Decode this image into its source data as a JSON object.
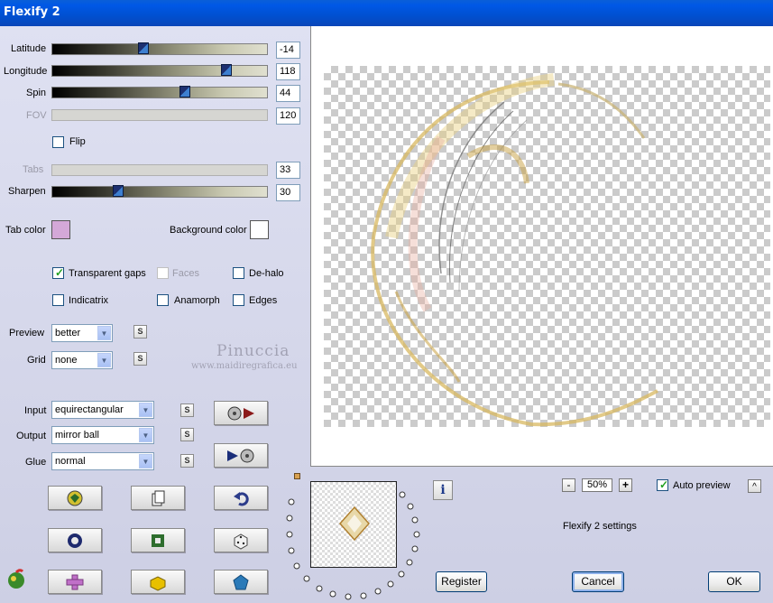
{
  "window": {
    "title": "Flexify 2"
  },
  "sliders": [
    {
      "label": "Latitude",
      "value": "-14",
      "enabled": true,
      "fraction": 0.43
    },
    {
      "label": "Longitude",
      "value": "118",
      "enabled": true,
      "fraction": 0.81
    },
    {
      "label": "Spin",
      "value": "44",
      "enabled": true,
      "fraction": 0.62
    },
    {
      "label": "FOV",
      "value": "120",
      "enabled": false
    },
    {
      "label": "Tabs",
      "value": "33",
      "enabled": false
    },
    {
      "label": "Sharpen",
      "value": "30",
      "enabled": true,
      "fraction": 0.3
    }
  ],
  "flip": {
    "label": "Flip",
    "checked": false
  },
  "colors": {
    "tab_label": "Tab color",
    "tab_color": "#d4a8d8",
    "background_label": "Background color",
    "background_color": "#ffffff"
  },
  "options": {
    "transparent_gaps": {
      "label": "Transparent gaps",
      "checked": true
    },
    "faces": {
      "label": "Faces",
      "checked": false
    },
    "dehalo": {
      "label": "De-halo",
      "checked": false
    },
    "indicatrix": {
      "label": "Indicatrix",
      "checked": false
    },
    "anamorph": {
      "label": "Anamorph",
      "checked": false
    },
    "edges": {
      "label": "Edges",
      "checked": false
    }
  },
  "preview_select": {
    "label": "Preview",
    "value": "better"
  },
  "grid_select": {
    "label": "Grid",
    "value": "none"
  },
  "input_select": {
    "label": "Input",
    "value": "equirectangular"
  },
  "output_select": {
    "label": "Output",
    "value": "mirror ball"
  },
  "glue_select": {
    "label": "Glue",
    "value": "normal"
  },
  "s_label": "S",
  "watermark": {
    "name": "Pinuccia",
    "url": "www.maidiregrafica.eu"
  },
  "zoom": {
    "minus": "-",
    "value": "50%",
    "plus": "+"
  },
  "auto_preview": {
    "label": "Auto preview",
    "checked": true
  },
  "collapse_label": "^",
  "info_label": "i",
  "settings_label": "Flexify 2 settings",
  "buttons": {
    "register": "Register",
    "cancel": "Cancel",
    "ok": "OK"
  },
  "accent_colors": {
    "title_bar": "#0058e6",
    "panel": "#d4d0e8",
    "check": "#21a121"
  }
}
